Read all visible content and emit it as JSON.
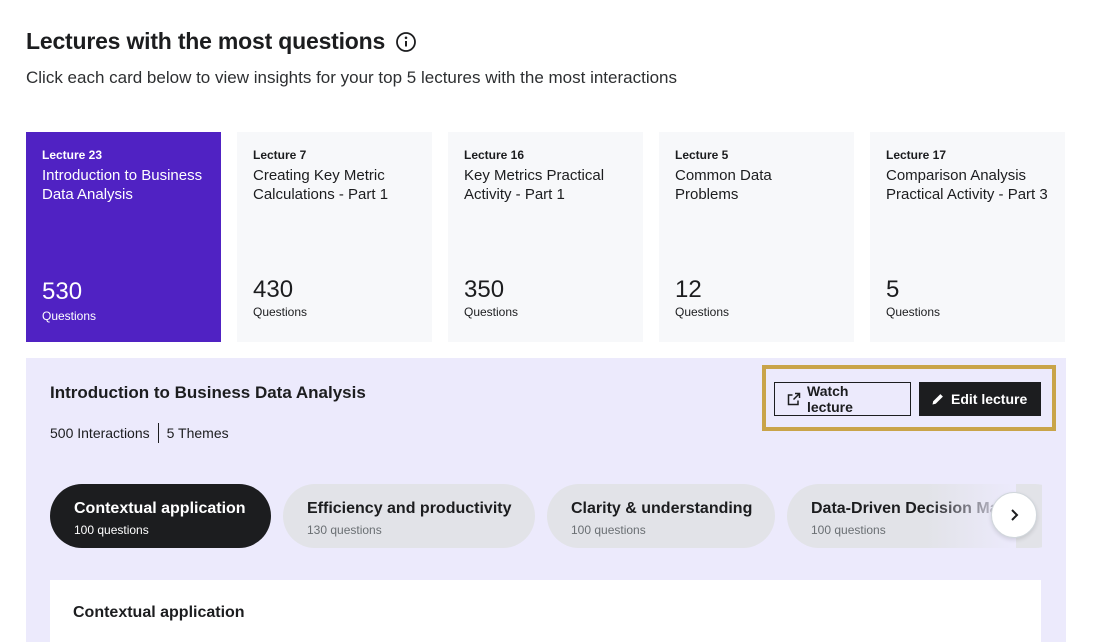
{
  "header": {
    "title": "Lectures with the most questions",
    "subtitle": "Click each card below to view insights for your top 5 lectures with the most interactions"
  },
  "cards": [
    {
      "lecture": "Lecture 23",
      "name": "Introduction to Business Data Analysis",
      "count": "530",
      "label": "Questions",
      "active": true
    },
    {
      "lecture": "Lecture 7",
      "name": "Creating Key Metric Calculations - Part 1",
      "count": "430",
      "label": "Questions"
    },
    {
      "lecture": "Lecture 16",
      "name": "Key Metrics Practical Activity - Part 1",
      "count": "350",
      "label": "Questions"
    },
    {
      "lecture": "Lecture 5",
      "name": "Common Data Problems",
      "count": "12",
      "label": "Questions"
    },
    {
      "lecture": "Lecture 17",
      "name": "Comparison Analysis Practical Activity - Part 3",
      "count": "5",
      "label": "Questions"
    }
  ],
  "panel": {
    "title": "Introduction to Business Data Analysis",
    "interactions": "500 Interactions",
    "themes_count": "5 Themes",
    "watch_label": "Watch lecture",
    "edit_label": "Edit lecture",
    "highlight_color": "#c9a449"
  },
  "themes": [
    {
      "name": "Contextual application",
      "count": "100 questions",
      "active": true
    },
    {
      "name": "Efficiency and productivity",
      "count": "130 questions"
    },
    {
      "name": "Clarity & understanding",
      "count": "100 questions"
    },
    {
      "name": "Data-Driven Decision Making",
      "count": "100 questions"
    }
  ],
  "detail": {
    "title": "Contextual application"
  },
  "colors": {
    "accent": "#5022c3",
    "panel_bg": "#eceafc",
    "dark": "#1c1d1f"
  }
}
